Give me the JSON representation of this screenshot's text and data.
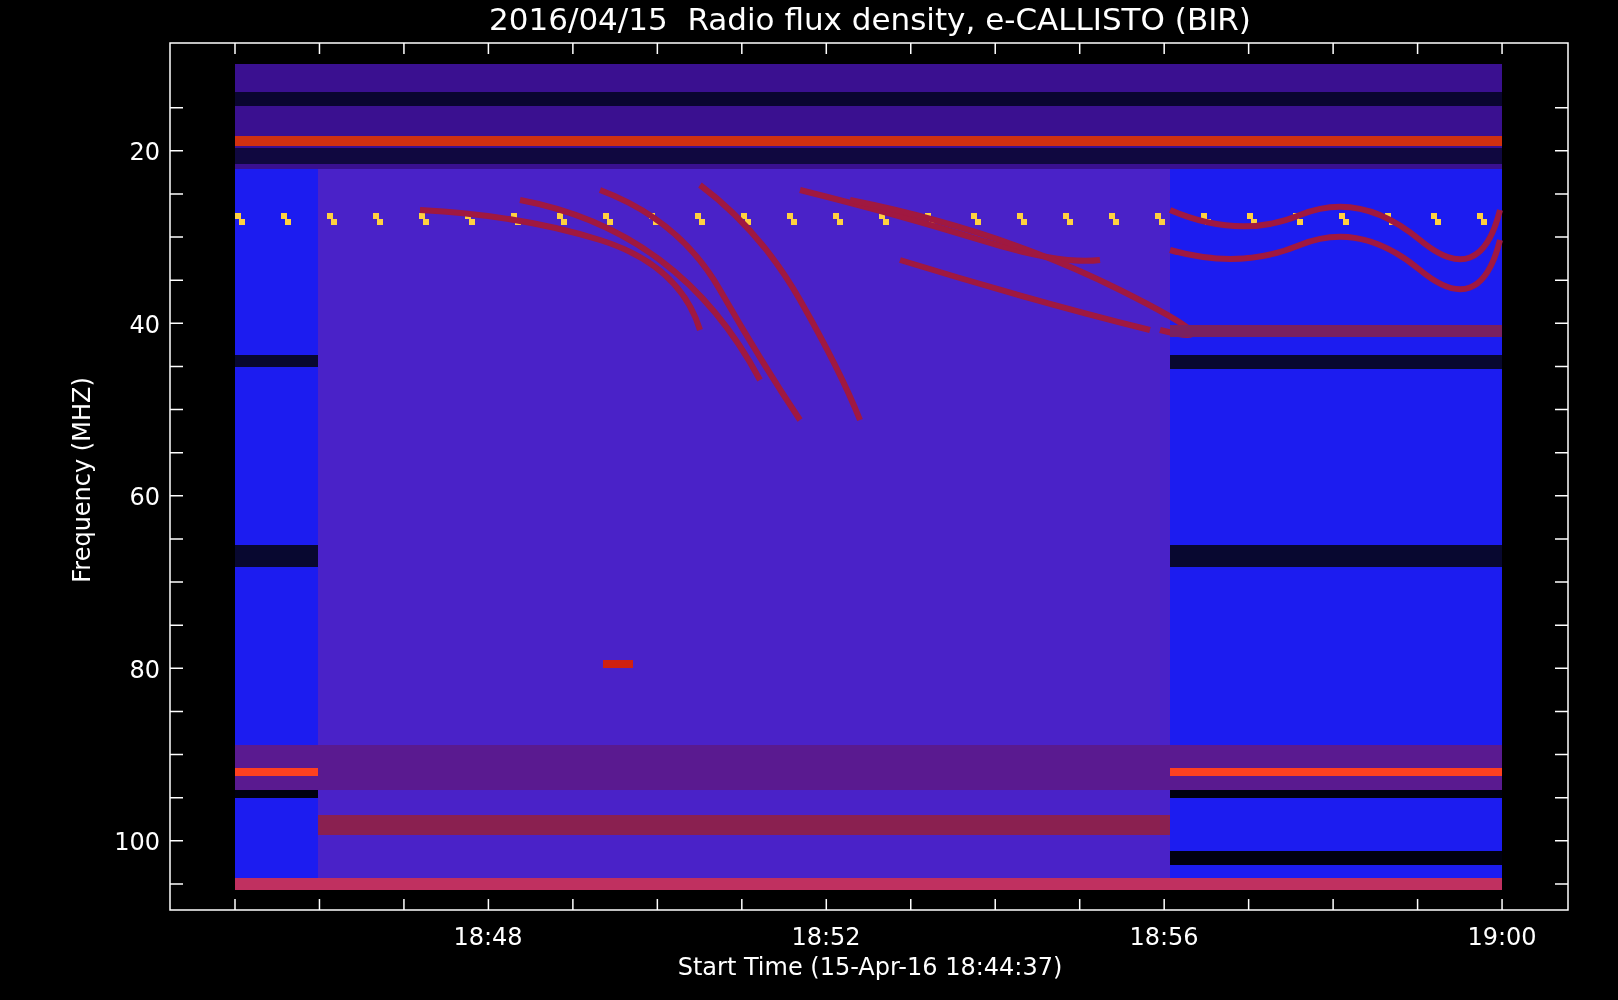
{
  "title": "2016/04/15  Radio flux density, e-CALLISTO (BIR)",
  "y_axis": {
    "label": "Frequency (MHZ)",
    "ticks": [
      "20",
      "40",
      "60",
      "80",
      "100"
    ]
  },
  "x_axis": {
    "label": "Start Time (15-Apr-16 18:44:37)",
    "ticks": [
      "18:48",
      "18:52",
      "18:56",
      "19:00"
    ]
  }
}
